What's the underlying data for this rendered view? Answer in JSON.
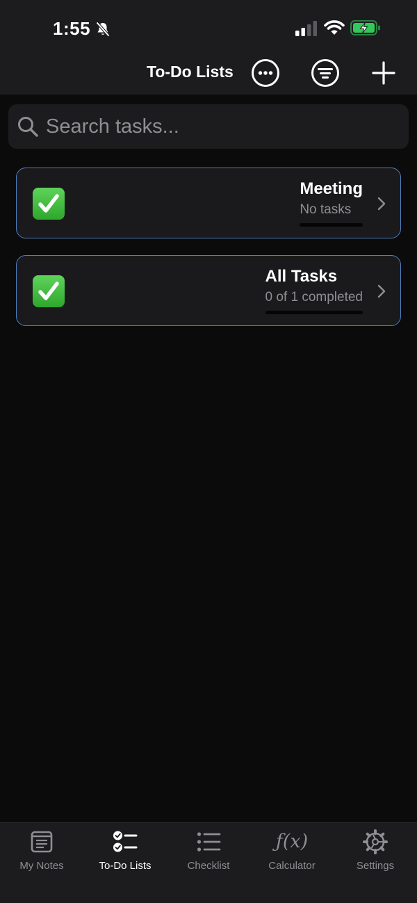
{
  "status_bar": {
    "time": "1:55",
    "silent_icon": "bell-slash-icon",
    "signal_icon": "cellular-signal-icon",
    "wifi_icon": "wifi-icon",
    "battery_icon": "battery-charging-icon",
    "battery_color": "#34c759"
  },
  "nav": {
    "title": "To-Do Lists",
    "more_icon": "ellipsis-circle-icon",
    "filter_icon": "filter-circle-icon",
    "add_icon": "plus-icon"
  },
  "search": {
    "placeholder": "Search tasks...",
    "value": ""
  },
  "lists": [
    {
      "icon": "white-check-mark-emoji-icon",
      "name": "Meeting",
      "summary": "No tasks",
      "progress": 0
    },
    {
      "icon": "white-check-mark-emoji-icon",
      "name": "All Tasks",
      "summary": "0 of 1 completed",
      "progress": 0
    }
  ],
  "tabs": [
    {
      "label": "My Notes",
      "icon": "note-icon",
      "active": false
    },
    {
      "label": "To-Do Lists",
      "icon": "checklist-icon",
      "active": true
    },
    {
      "label": "Checklist",
      "icon": "list-bullet-icon",
      "active": false
    },
    {
      "label": "Calculator",
      "icon": "function-icon",
      "glyph": "ƒ(x)",
      "active": false
    },
    {
      "label": "Settings",
      "icon": "gear-icon",
      "active": false
    }
  ],
  "colors": {
    "background": "#0b0b0b",
    "surface": "#1c1c1e",
    "card_border": "#4f7fbf",
    "secondary_text": "#8e8e93",
    "check_green": "#34c759"
  }
}
